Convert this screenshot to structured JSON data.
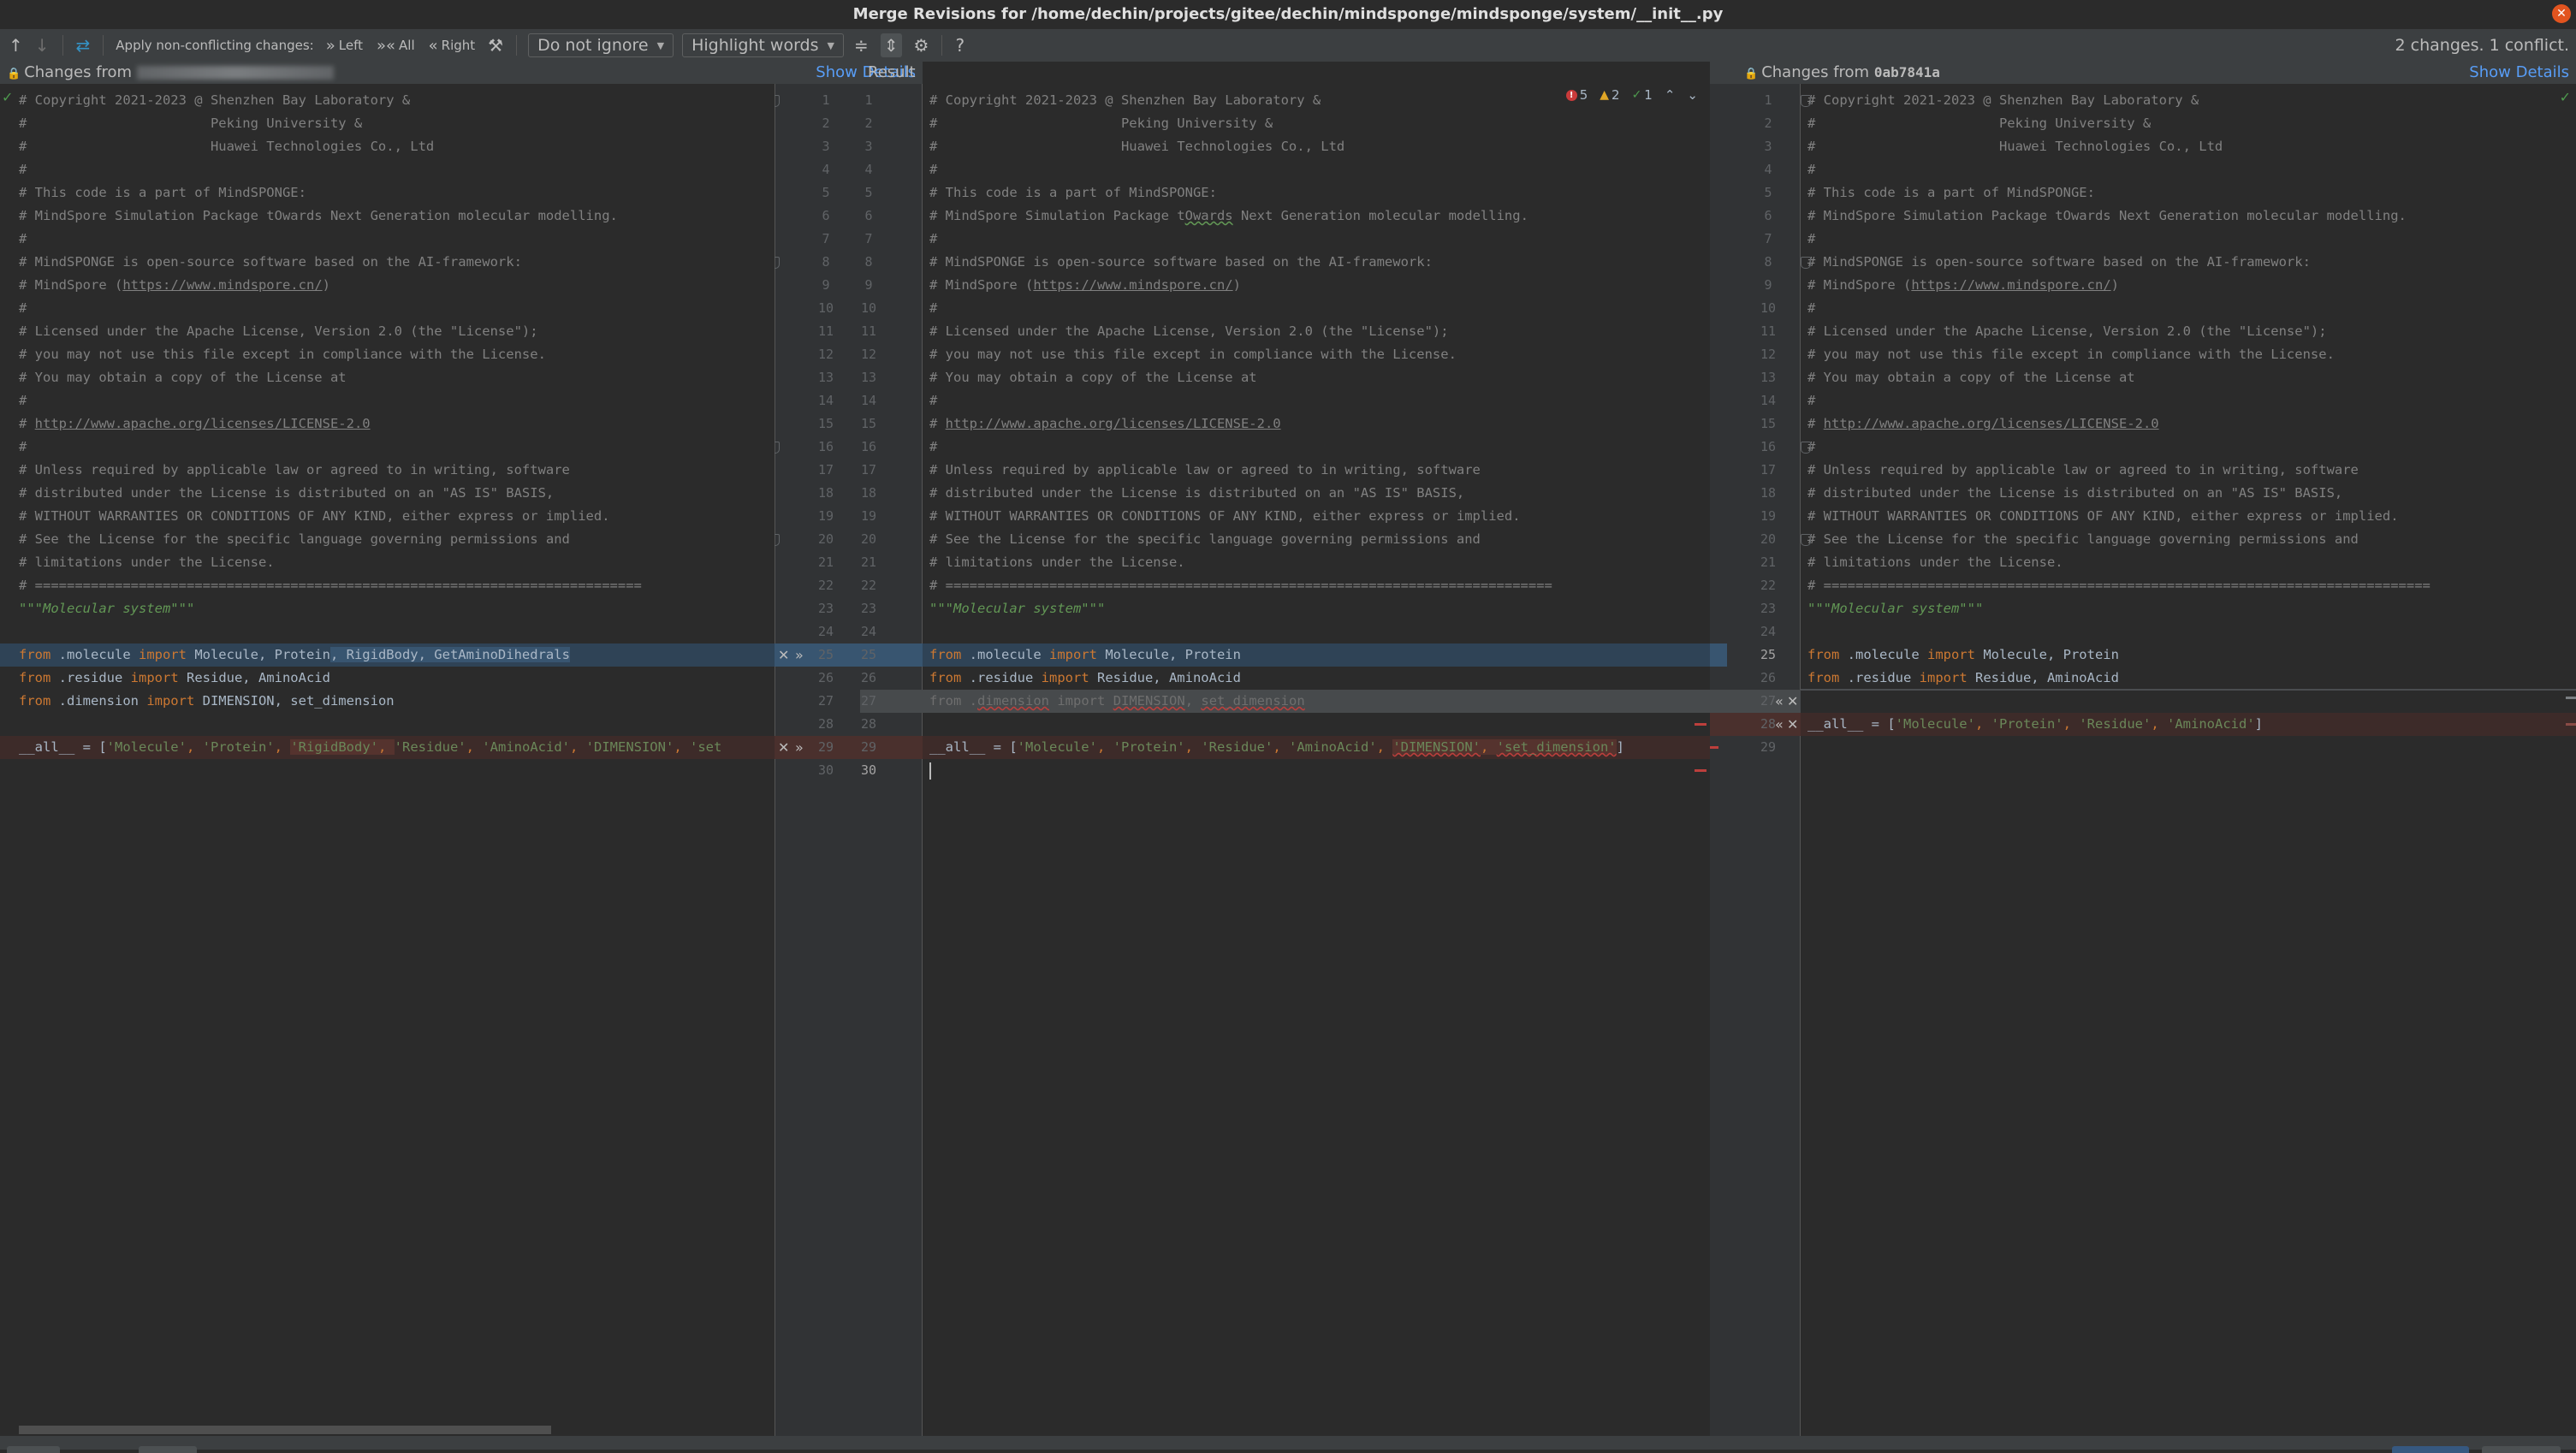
{
  "window": {
    "title": "Merge Revisions for /home/dechin/projects/gitee/dechin/mindsponge/mindsponge/system/__init__.py",
    "close_icon": "close-icon"
  },
  "toolbar": {
    "prev_change": "↑",
    "next_change": "↓",
    "resolve_icon": "⇄",
    "apply_label": "Apply non-conflicting changes:",
    "apply_left": "Left",
    "apply_all": "All",
    "apply_right": "Right",
    "magic_icon": "⚒",
    "ignore_select": "Do not ignore",
    "highlight_select": "Highlight words",
    "collapse_icon": "≑",
    "sync_scroll_icon": "⇕",
    "settings_icon": "⚙",
    "help_icon": "?",
    "status": "2 changes. 1 conflict."
  },
  "left_header": {
    "label": "Changes from",
    "revision": "",
    "show_details": "Show Details"
  },
  "result_header": {
    "label": "Result",
    "errors": "5",
    "warnings": "2",
    "typos": "1"
  },
  "right_header": {
    "label": "Changes from",
    "revision": "0ab7841a",
    "show_details": "Show Details"
  },
  "header_lines": [
    "# Copyright 2021-2023 @ Shenzhen Bay Laboratory &",
    "#                       Peking University &",
    "#                       Huawei Technologies Co., Ltd",
    "#",
    "# This code is a part of MindSPONGE:",
    "# MindSpore Simulation Package tOwards Next Generation molecular modelling.",
    "#",
    "# MindSPONGE is open-source software based on the AI-framework:",
    "# MindSpore (",
    "#",
    "# Licensed under the Apache License, Version 2.0 (the \"License\");",
    "# you may not use this file except in compliance with the License.",
    "# You may obtain a copy of the License at",
    "#",
    "# ",
    "#",
    "# Unless required by applicable law or agreed to in writing, software",
    "# distributed under the License is distributed on an \"AS IS\" BASIS,",
    "# WITHOUT WARRANTIES OR CONDITIONS OF ANY KIND, either express or implied.",
    "# See the License for the specific language governing permissions and",
    "# limitations under the License.",
    "# ============================================================================",
    "\"\"\"Molecular system\"\"\""
  ],
  "links": {
    "mindspore": "https://www.mindspore.cn/",
    "apache": "http://www.apache.org/licenses/LICENSE-2.0"
  },
  "tokens": {
    "from": "from",
    "import": "import",
    "molecule_mod": " .molecule ",
    "residue_mod": " .residue ",
    "dimension_mod": " .dimension ",
    "mol_names": " Molecule, Protein",
    "mol_extra": ", RigidBody, GetAminoDihedrals",
    "res_names": " Residue, AminoAcid",
    "dim_names": " DIMENSION, set_dimension",
    "all_prefix": "__all__ = [",
    "close_paren": ")",
    "close_bracket": "]"
  },
  "left_all": {
    "s1": "'Molecule'",
    "s2": "'Protein'",
    "s3": "'RigidBody'",
    "s4": "'Residue'",
    "s5": "'AminoAcid'",
    "s6": "'DIMENSION'",
    "s7": "'set"
  },
  "result_all": {
    "s1": "'Molecule'",
    "s2": "'Protein'",
    "s3": "'Residue'",
    "s4": "'AminoAcid'",
    "s5": "'DIMENSION'",
    "s6": "'set_dimension'"
  },
  "right_all": {
    "s1": "'Molecule'",
    "s2": "'Protein'",
    "s3": "'Residue'",
    "s4": "'AminoAcid'"
  },
  "gutter": {
    "left_line_count": 30,
    "result_line_count": 30,
    "right_line_count": 29,
    "accept_left": "»",
    "accept_right": "«",
    "reject": "✕"
  },
  "colors": {
    "modified": "#2f4356",
    "conflict": "#3d2b29",
    "deleted": "#474a4c",
    "error": "#bc3f3c",
    "link": "#589df6"
  }
}
